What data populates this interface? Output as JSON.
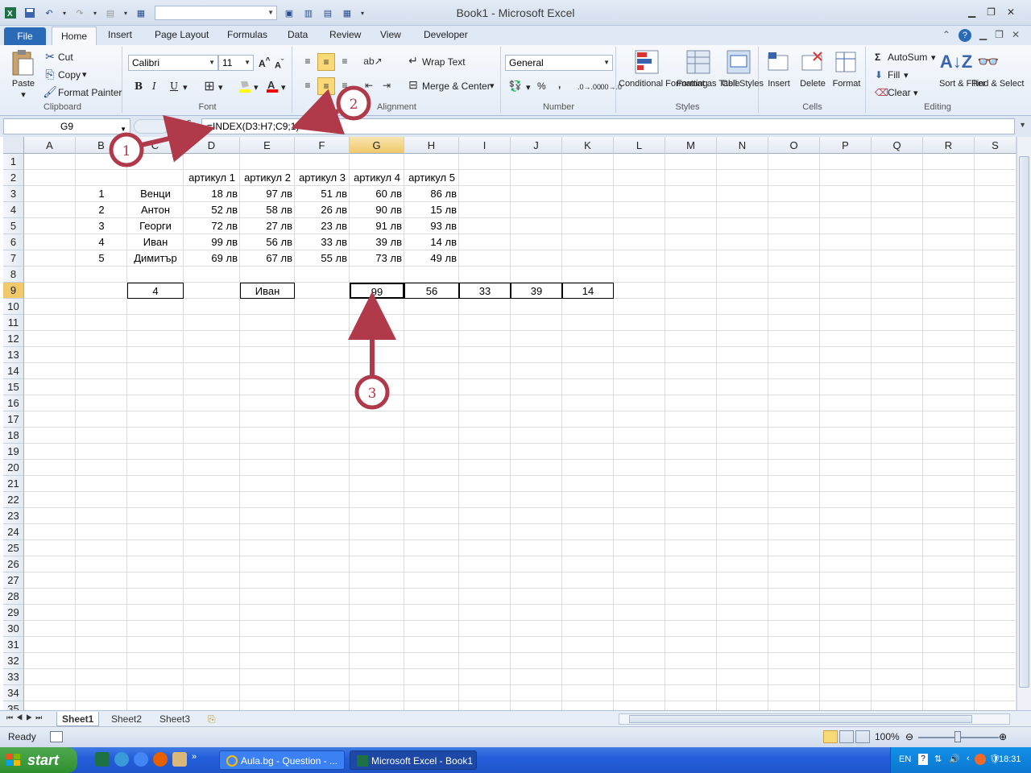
{
  "window": {
    "title": "Book1  -  Microsoft Excel"
  },
  "ribbon_tabs": [
    "File",
    "Home",
    "Insert",
    "Page Layout",
    "Formulas",
    "Data",
    "Review",
    "View",
    "Developer"
  ],
  "clipboard": {
    "paste": "Paste",
    "cut": "Cut",
    "copy": "Copy",
    "format_painter": "Format Painter",
    "label": "Clipboard"
  },
  "font": {
    "name": "Calibri",
    "size": "11",
    "label": "Font",
    "bold": "B",
    "italic": "I",
    "underline": "U"
  },
  "alignment": {
    "wrap_text": "Wrap Text",
    "merge_center": "Merge & Center",
    "label": "Alignment"
  },
  "number": {
    "format": "General",
    "percent": "%",
    "comma": ",",
    "label": "Number"
  },
  "styles": {
    "conditional": "Conditional Formatting",
    "format_table": "Format as Table",
    "cell_styles": "Cell Styles",
    "label": "Styles"
  },
  "cells_group": {
    "insert": "Insert",
    "delete": "Delete",
    "format": "Format",
    "label": "Cells"
  },
  "editing": {
    "autosum": "AutoSum",
    "fill": "Fill",
    "clear": "Clear",
    "sort_filter": "Sort & Filter",
    "find_select": "Find & Select",
    "label": "Editing"
  },
  "formula_bar": {
    "name_box": "G9",
    "fx": "fx",
    "formula": "=INDEX(D3:H7;C9;1)"
  },
  "columns": [
    "A",
    "B",
    "C",
    "D",
    "E",
    "F",
    "G",
    "H",
    "I",
    "J",
    "K",
    "L",
    "M",
    "N",
    "O",
    "P",
    "Q",
    "R",
    "S"
  ],
  "rows": [
    "1",
    "2",
    "3",
    "4",
    "5",
    "6",
    "7",
    "8",
    "9",
    "10",
    "11",
    "12",
    "13",
    "14",
    "15",
    "16",
    "17",
    "18",
    "19",
    "20",
    "21",
    "22",
    "23",
    "24",
    "25",
    "26",
    "27",
    "28",
    "29",
    "30",
    "31",
    "32",
    "33",
    "34",
    "35"
  ],
  "sheet": {
    "headers": [
      "артикул 1",
      "артикул 2",
      "артикул 3",
      "артикул 4",
      "артикул 5"
    ],
    "table": [
      {
        "num": "1",
        "name": "Венци",
        "vals": [
          "18 лв",
          "97 лв",
          "51 лв",
          "60 лв",
          "86 лв"
        ]
      },
      {
        "num": "2",
        "name": "Антон",
        "vals": [
          "52 лв",
          "58 лв",
          "26 лв",
          "90 лв",
          "15 лв"
        ]
      },
      {
        "num": "3",
        "name": "Георги",
        "vals": [
          "72 лв",
          "27 лв",
          "23 лв",
          "91 лв",
          "93 лв"
        ]
      },
      {
        "num": "4",
        "name": "Иван",
        "vals": [
          "99 лв",
          "56 лв",
          "33 лв",
          "39 лв",
          "14 лв"
        ]
      },
      {
        "num": "5",
        "name": "Димитър",
        "vals": [
          "69 лв",
          "67 лв",
          "55 лв",
          "73 лв",
          "49 лв"
        ]
      }
    ],
    "row9": {
      "c9": "4",
      "e9": "Иван",
      "g9": "99",
      "h9": "56",
      "i9": "33",
      "j9": "39",
      "k9": "14"
    }
  },
  "annotations": [
    "1",
    "2",
    "3"
  ],
  "sheet_tabs": [
    "Sheet1",
    "Sheet2",
    "Sheet3"
  ],
  "status": {
    "ready": "Ready",
    "zoom": "100%"
  },
  "taskbar": {
    "start": "start",
    "app1": "Aula.bg - Question - ...",
    "app2": "Microsoft Excel - Book1",
    "lang": "EN",
    "time": "18:31"
  },
  "colors": {
    "file_tab": "#2b6ab7",
    "selection_header": "#f1c86a",
    "annotation": "#b03a4a",
    "taskbar": "#245edb"
  }
}
